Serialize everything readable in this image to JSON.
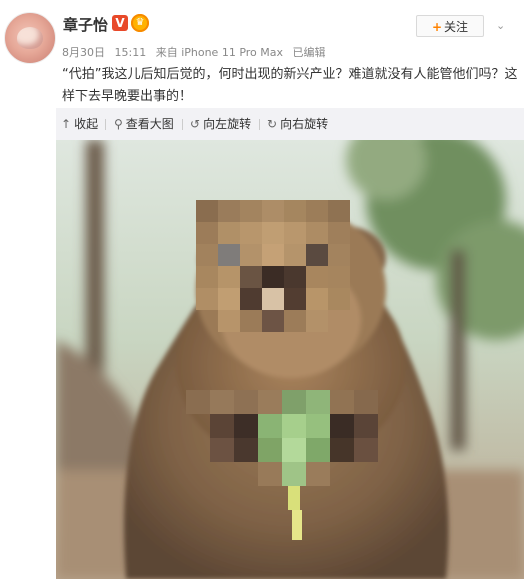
{
  "user": {
    "name": "章子怡",
    "verify_badge": "V",
    "member_badge": "♛"
  },
  "meta": {
    "date": "8月30日",
    "time": "15:11",
    "source": "来自 iPhone 11 Pro Max",
    "edited": "已编辑"
  },
  "follow": {
    "plus": "+",
    "label": "关注"
  },
  "post": {
    "text": "“代拍”我这儿后知后觉的，何时出现的新兴产业？难道就没有人能管他们吗？这样下去早晚要出事的！"
  },
  "toolbar": {
    "collapse": "收起",
    "view_large": "查看大图",
    "rotate_left": "向左旋转",
    "rotate_right": "向右旋转"
  },
  "icons": {
    "collapse": "↑",
    "view_large": "⚲",
    "rotate_left": "↺",
    "rotate_right": "↻",
    "chevron": "⌄"
  },
  "colors": {
    "accent": "#ff8200",
    "verify": "#e8492a",
    "toolbar_bg": "#f2f2f5",
    "meta_text": "#888888"
  }
}
